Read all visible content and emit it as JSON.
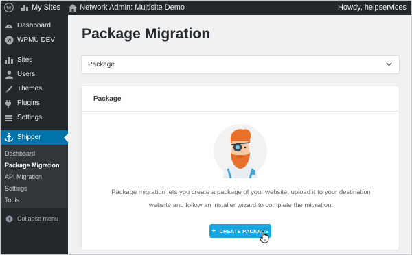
{
  "admin_bar": {
    "my_sites": "My Sites",
    "network_admin": "Network Admin: Multisite Demo",
    "howdy": "Howdy, helpservices"
  },
  "sidebar": {
    "items": [
      {
        "label": "Dashboard",
        "icon": "dashboard-icon"
      },
      {
        "label": "WPMU DEV",
        "icon": "wpmudev-icon"
      },
      {
        "label": "Sites",
        "icon": "sites-icon"
      },
      {
        "label": "Users",
        "icon": "users-icon"
      },
      {
        "label": "Themes",
        "icon": "themes-icon"
      },
      {
        "label": "Plugins",
        "icon": "plugins-icon"
      },
      {
        "label": "Settings",
        "icon": "settings-icon"
      },
      {
        "label": "Shipper",
        "icon": "anchor-icon"
      }
    ],
    "submenu": [
      "Dashboard",
      "Package Migration",
      "API Migration",
      "Settings",
      "Tools"
    ],
    "collapse_label": "Collapse menu"
  },
  "page": {
    "title": "Package Migration",
    "select_value": "Package",
    "panel_title": "Package",
    "description_line1": "Package migration lets you create a package of your website, upload it to your destination",
    "description_line2": "website and follow an installer wizard to complete the migration.",
    "button_label": "CREATE PACKAGE"
  },
  "colors": {
    "admin_dark": "#23282d",
    "active_blue": "#0073aa",
    "button_blue": "#17a8e3"
  }
}
